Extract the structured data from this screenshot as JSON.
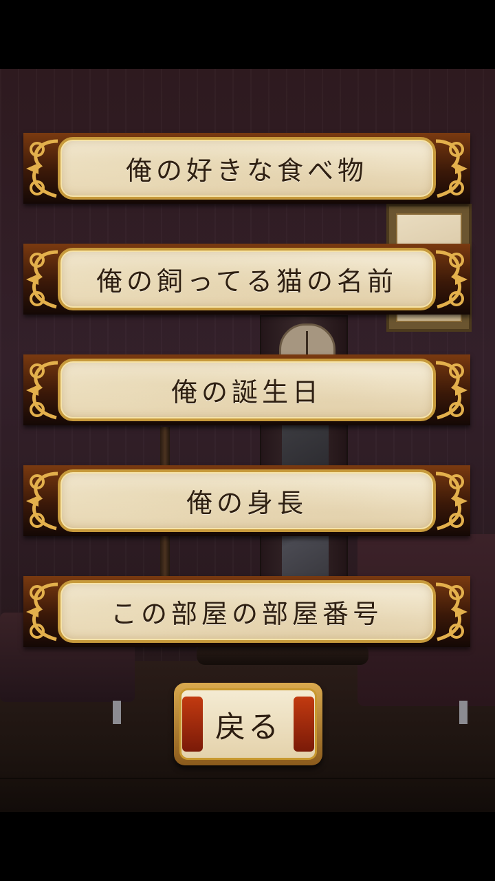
{
  "menu": {
    "items": [
      {
        "label": "俺の好きな食べ物"
      },
      {
        "label": "俺の飼ってる猫の名前"
      },
      {
        "label": "俺の誕生日"
      },
      {
        "label": "俺の身長"
      },
      {
        "label": "この部屋の部屋番号"
      }
    ],
    "back_label": "戻る"
  },
  "icons": [
    "scroll-ornament-icon"
  ],
  "colors": {
    "plate": "#efe3c6",
    "frame_gold": "#c79a3c",
    "frame_brown": "#5a2a0c",
    "background": "#2e1a1f"
  }
}
